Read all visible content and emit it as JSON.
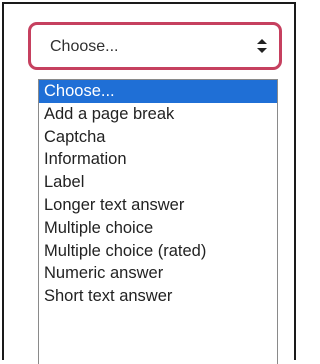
{
  "select": {
    "value": "Choose...",
    "arrow_icon": "up-down-chevron-icon"
  },
  "dropdown": {
    "selected_index": 0,
    "options": [
      "Choose...",
      "Add a page break",
      "Captcha",
      "Information",
      "Label",
      "Longer text answer",
      "Multiple choice",
      "Multiple choice (rated)",
      "Numeric answer",
      "Short text answer"
    ]
  },
  "colors": {
    "focus_border": "#c6405f",
    "selected_background": "#1f6fd6",
    "selected_text": "#ffffff",
    "option_text": "#222222"
  }
}
